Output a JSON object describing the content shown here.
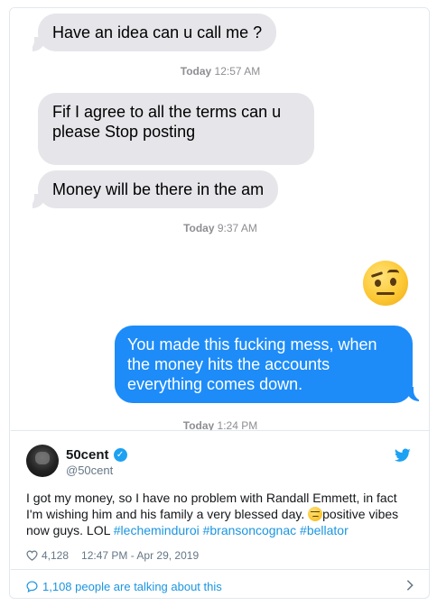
{
  "messages": {
    "m1": "Have an idea can u call me ?",
    "stamp1_day": "Today",
    "stamp1_time": "12:57 AM",
    "m2": "Fif I agree to all the terms can u please Stop posting",
    "m3": "Money will be there in the am",
    "stamp2_day": "Today",
    "stamp2_time": "9:37 AM",
    "emoji": "raised-eyebrow-face",
    "m4": "You made this fucking mess, when the money hits the accounts everything comes down.",
    "stamp3_day": "Today",
    "stamp3_time": "1:24 PM"
  },
  "tweet": {
    "name": "50cent",
    "handle": "@50cent",
    "text_before": "I got my money, so I have no problem with Randall Emmett, in fact I'm wishing him and his family a very blessed day. ",
    "text_after": "positive vibes now guys. LOL ",
    "hashtag1": "#lecheminduroi",
    "hashtag2": "#bransoncognac",
    "hashtag3": "#bellator",
    "likes": "4,128",
    "timestamp": "12:47 PM - Apr 29, 2019",
    "talking": "1,108 people are talking about this"
  },
  "colors": {
    "imessage_blue": "#1d8cf8",
    "incoming_gray": "#e5e5ea",
    "twitter_blue": "#1da1f2",
    "link_blue": "#1b95e0"
  }
}
